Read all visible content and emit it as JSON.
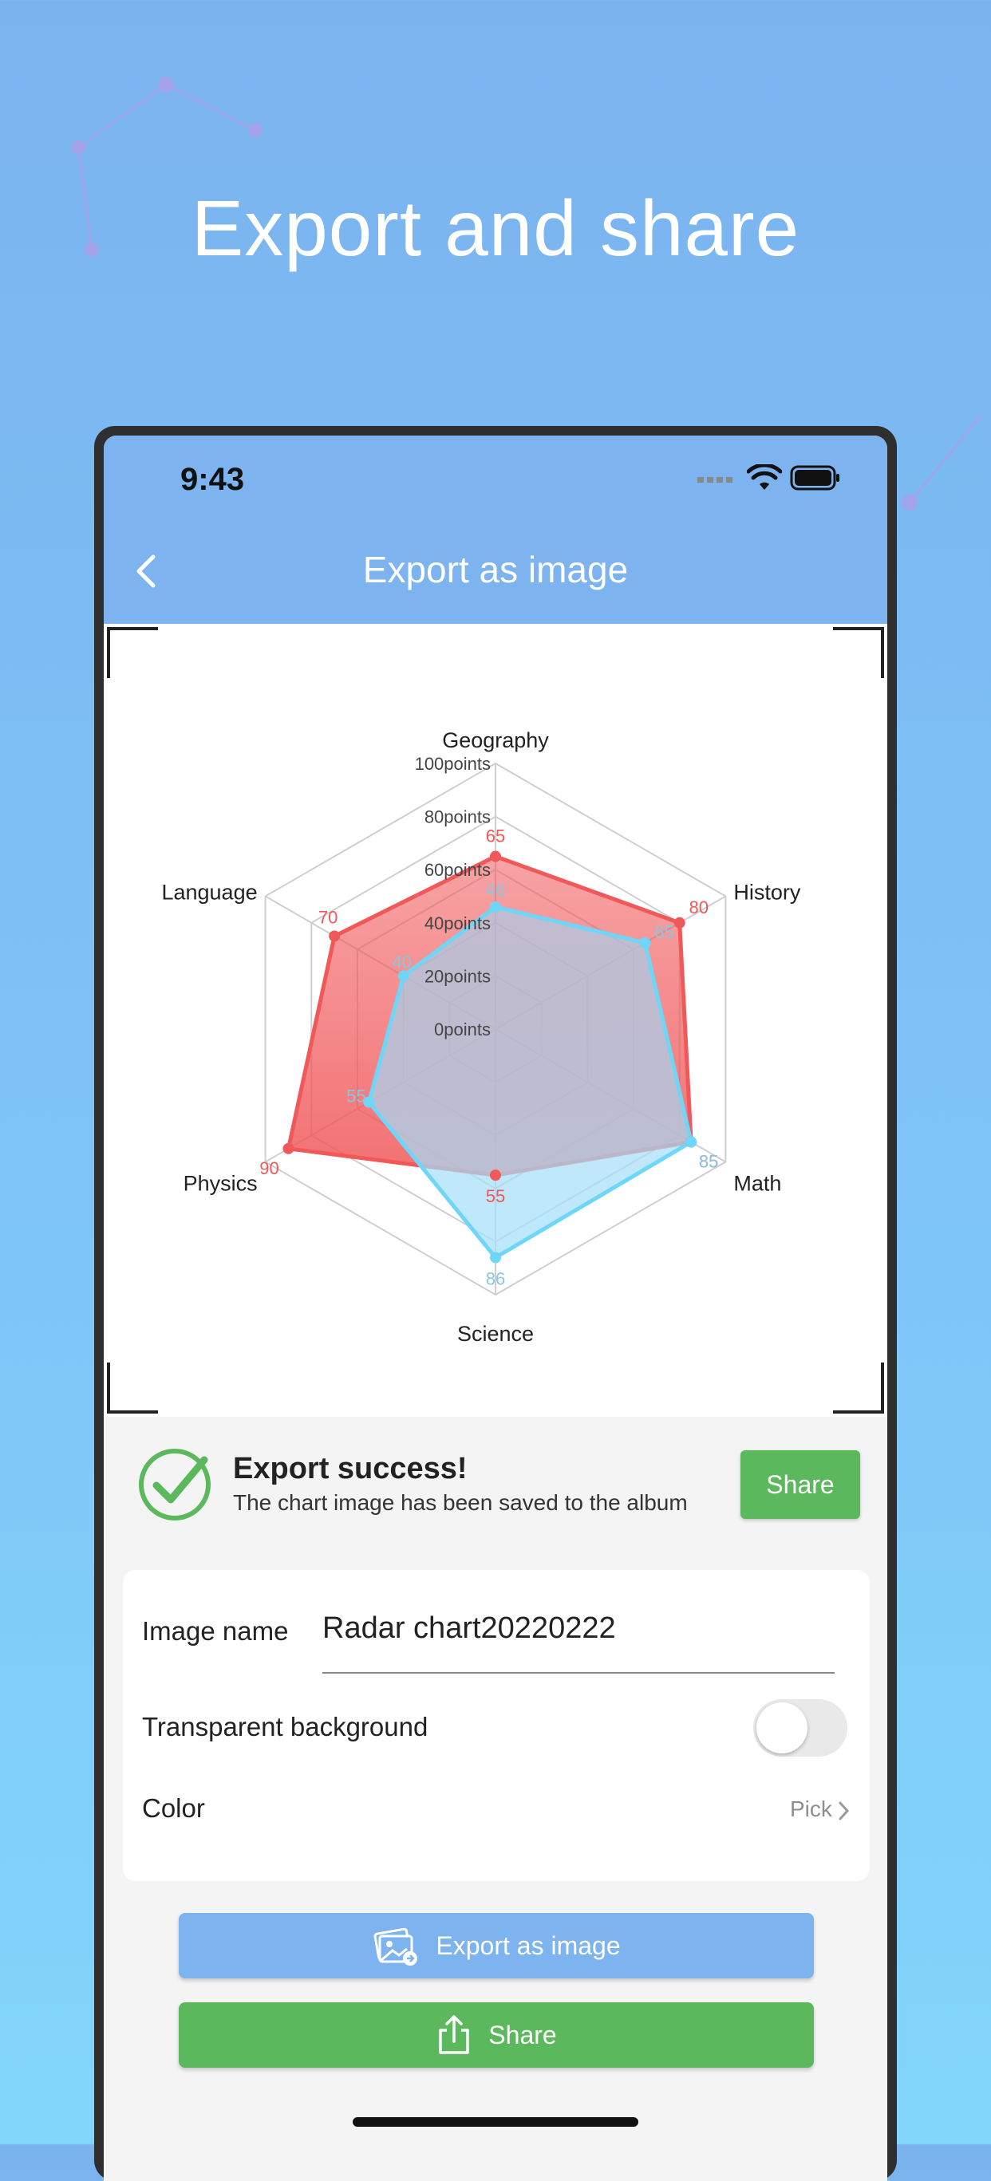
{
  "headline": "Export and share",
  "status_bar": {
    "time": "9:43"
  },
  "nav": {
    "title": "Export as image"
  },
  "chart_data": {
    "type": "radar",
    "axes": [
      "Geography",
      "History",
      "Math",
      "Science",
      "Physics",
      "Language"
    ],
    "scale_labels": [
      "0points",
      "20points",
      "40points",
      "60points",
      "80points",
      "100points"
    ],
    "range": [
      0,
      100
    ],
    "series": [
      {
        "color": "#f0585a",
        "values": [
          65,
          80,
          85,
          55,
          90,
          70
        ]
      },
      {
        "color": "#6fd6f7",
        "values": [
          46,
          65,
          85,
          86,
          55,
          40
        ]
      }
    ]
  },
  "success": {
    "title": "Export success!",
    "message": "The chart image has been saved to the album",
    "share_label": "Share"
  },
  "settings": {
    "image_name_label": "Image name",
    "image_name_value": "Radar chart20220222",
    "transparent_label": "Transparent background",
    "transparent_on": false,
    "color_label": "Color",
    "pick_label": "Pick"
  },
  "buttons": {
    "export_label": "Export as image",
    "share_label": "Share"
  },
  "colors": {
    "accent_blue": "#7db3ee",
    "accent_green": "#5cb85c"
  }
}
